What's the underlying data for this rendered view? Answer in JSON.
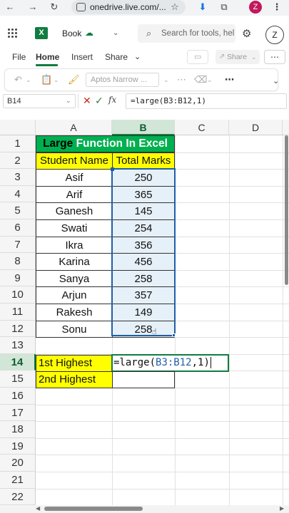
{
  "browser": {
    "url": "onedrive.live.com/...",
    "profile_initial": "Z"
  },
  "app": {
    "doc_title": "Book",
    "search_placeholder": "Search for tools, hel",
    "user_initial": "Z",
    "accent_color": "#107c41"
  },
  "ribbon": {
    "tabs": [
      "File",
      "Home",
      "Insert",
      "Share"
    ],
    "active_tab": "Home",
    "share_label": "Share",
    "more_label": "⋯"
  },
  "toolbar": {
    "font_name": "Aptos Narrow ..."
  },
  "formula_bar": {
    "name_box": "B14",
    "formula": "=large(B3:B12,1)"
  },
  "grid": {
    "columns": [
      "A",
      "B",
      "C",
      "D"
    ],
    "selected_column": "B",
    "rows": [
      "1",
      "2",
      "3",
      "4",
      "5",
      "6",
      "7",
      "8",
      "9",
      "10",
      "11",
      "12",
      "13",
      "14",
      "15",
      "16",
      "17",
      "18",
      "19",
      "20",
      "21",
      "22"
    ],
    "selected_row": "14",
    "title_part1": "Large",
    "title_part2": " Function In Excel",
    "header_name": "Student Name",
    "header_marks": "Total Marks",
    "students": [
      {
        "name": "Asif",
        "marks": "250"
      },
      {
        "name": "Arif",
        "marks": "365"
      },
      {
        "name": "Ganesh",
        "marks": "145"
      },
      {
        "name": "Swati",
        "marks": "254"
      },
      {
        "name": "Ikra",
        "marks": "356"
      },
      {
        "name": "Karina",
        "marks": "456"
      },
      {
        "name": "Sanya",
        "marks": "258"
      },
      {
        "name": "Arjun",
        "marks": "357"
      },
      {
        "name": "Rakesh",
        "marks": "149"
      },
      {
        "name": "Sonu",
        "marks": "258"
      }
    ],
    "label_first": "1st Highest",
    "label_second": "2nd Highest",
    "editing_prefix": "=large(",
    "editing_ref": "B3:B12",
    "editing_suffix": ",1)"
  },
  "colors": {
    "title_bg": "#00b050",
    "header_bg": "#ffff00",
    "selection": "#1f5fa8"
  }
}
